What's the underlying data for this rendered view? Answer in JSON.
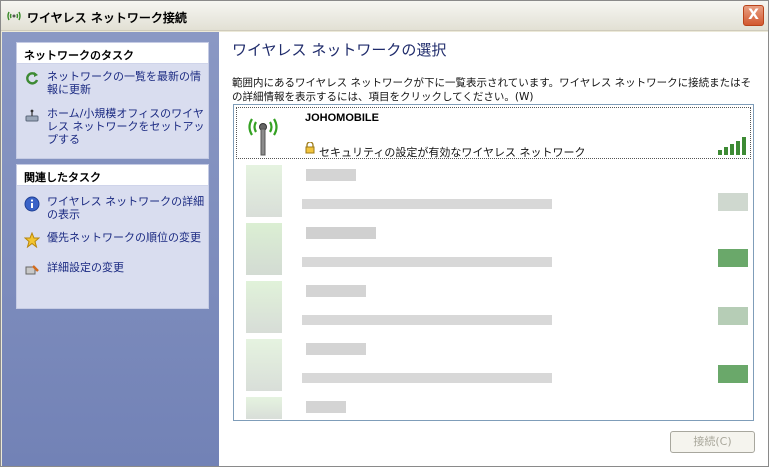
{
  "window": {
    "title": "ワイヤレス ネットワーク接続",
    "close_label": "X"
  },
  "sidebar": {
    "network_tasks": {
      "heading": "ネットワークのタスク",
      "items": [
        {
          "label": "ネットワークの一覧を最新の情報に更新",
          "icon": "refresh-icon"
        },
        {
          "label": "ホーム/小規模オフィスのワイヤレス ネットワークをセットアップする",
          "icon": "network-setup-icon"
        }
      ]
    },
    "related_tasks": {
      "heading": "関連したタスク",
      "items": [
        {
          "label": "ワイヤレス ネットワークの詳細の表示",
          "icon": "info-icon"
        },
        {
          "label": "優先ネットワークの順位の変更",
          "icon": "star-icon"
        },
        {
          "label": "詳細設定の変更",
          "icon": "settings-icon"
        }
      ]
    }
  },
  "main": {
    "title": "ワイヤレス ネットワークの選択",
    "description": "範囲内にあるワイヤレス ネットワークが下に一覧表示されています。ワイヤレス ネットワークに接続またはその詳細情報を表示するには、項目をクリックしてください。(W)",
    "networks": [
      {
        "ssid": "JOHOMOBILE",
        "security": "セキュリティの設定が有効なワイヤレス ネットワーク",
        "signal_bars": 5,
        "selected": true
      }
    ],
    "connect_button": "接続(C)"
  },
  "colors": {
    "sidebar_top": "#8a98c4",
    "sidebar_bottom": "#7282b6",
    "title_text": "#1f2b6b",
    "link_text": "#1b2a82",
    "signal_green": "#3d8a34"
  }
}
